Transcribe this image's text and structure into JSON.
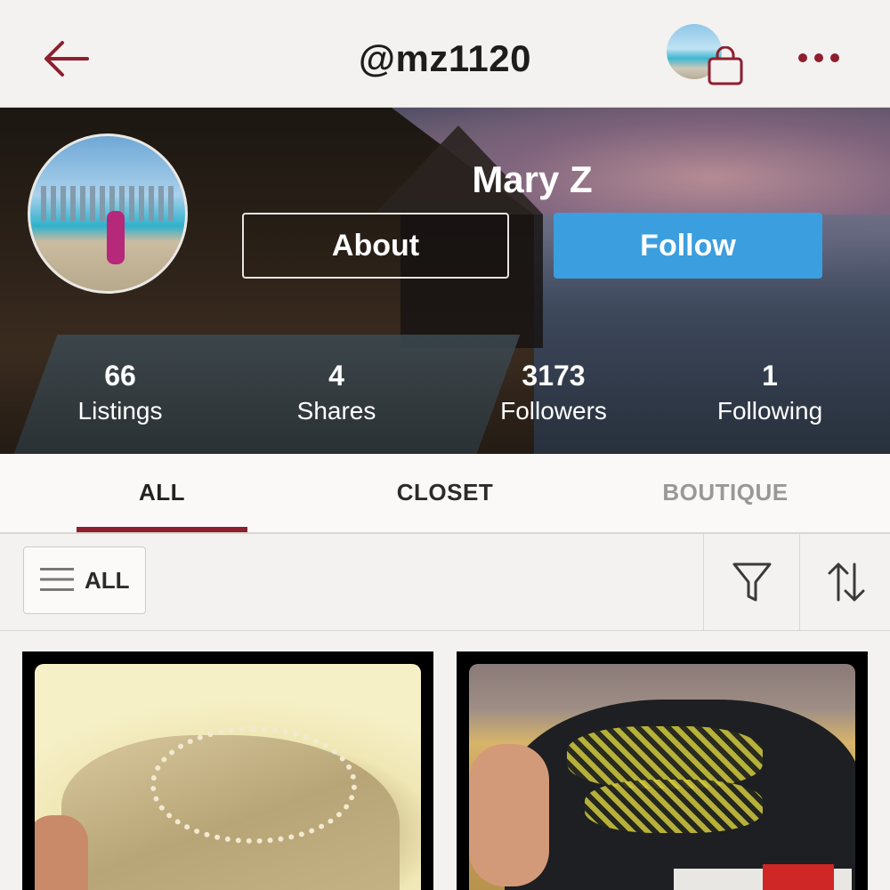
{
  "header": {
    "username": "@mz1120",
    "back_icon": "arrow-left-icon",
    "bag_icon": "shopping-bag-icon",
    "more_icon": "more-horizontal-icon",
    "accent": "#8d1f2f"
  },
  "profile": {
    "name": "Mary Z",
    "about_label": "About",
    "follow_label": "Follow",
    "follow_color": "#3b9ede",
    "stats": [
      {
        "value": "66",
        "label": "Listings"
      },
      {
        "value": "4",
        "label": "Shares"
      },
      {
        "value": "3173",
        "label": "Followers"
      },
      {
        "value": "1",
        "label": "Following"
      }
    ]
  },
  "tabs": {
    "items": [
      {
        "label": "ALL",
        "active": true
      },
      {
        "label": "CLOSET",
        "active": false
      },
      {
        "label": "BOUTIQUE",
        "active": false
      }
    ]
  },
  "filter": {
    "all_label": "ALL",
    "menu_icon": "menu-lines-icon",
    "filter_icon": "funnel-icon",
    "sort_icon": "sort-arrows-icon"
  },
  "listings": [
    {
      "image": "beige-sneaker-photo"
    },
    {
      "image": "black-yellow-sneaker-photo"
    }
  ]
}
